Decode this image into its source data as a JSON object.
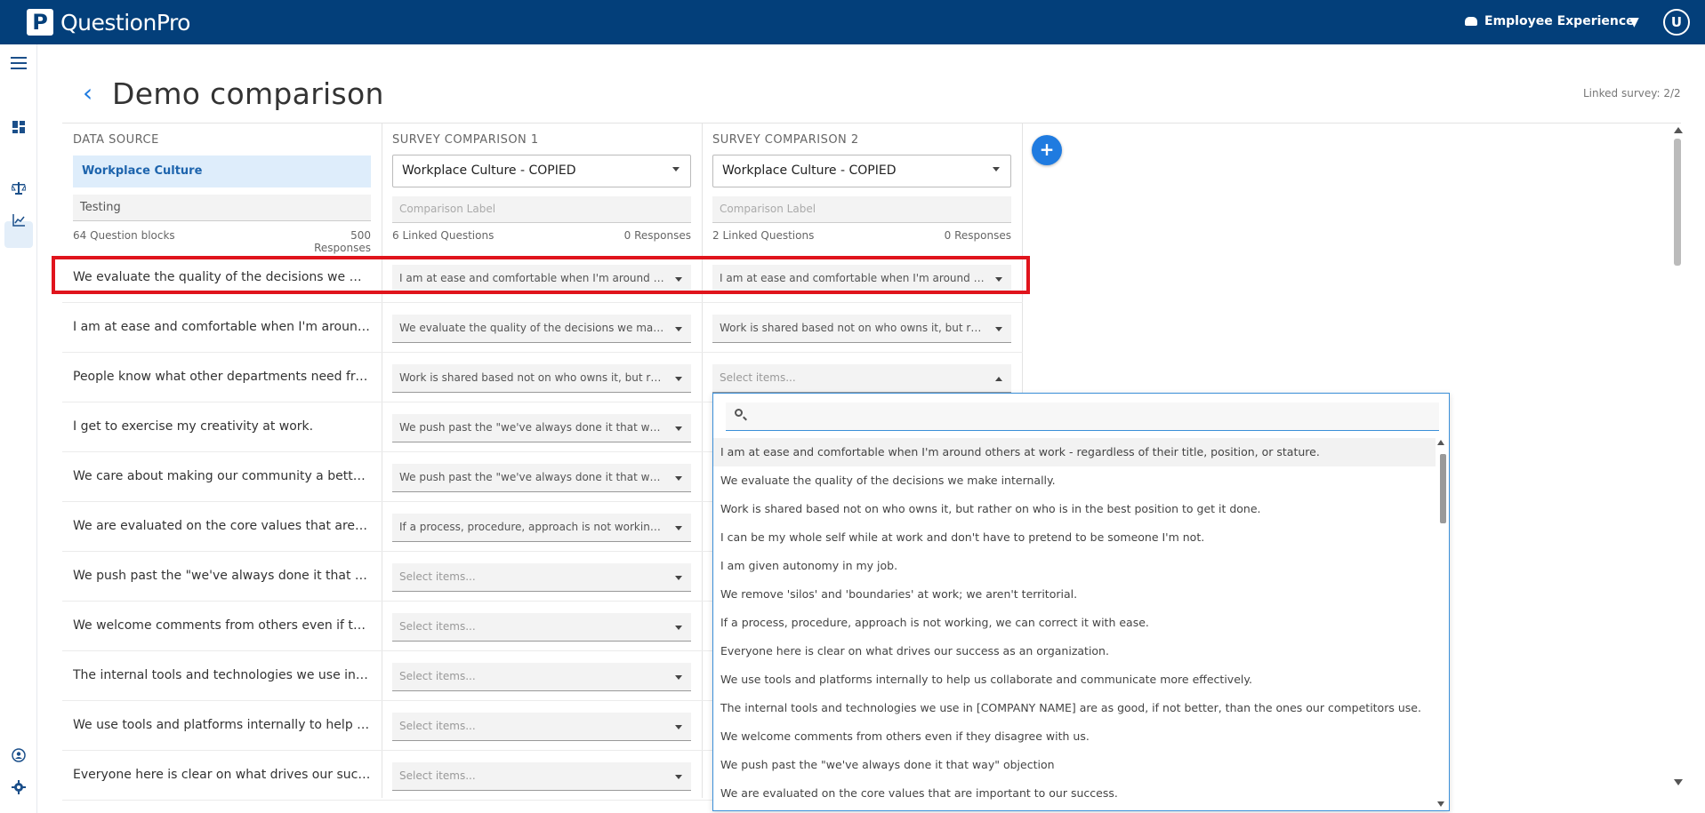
{
  "topbar": {
    "logo_letter": "P",
    "brand": "QuestionPro",
    "product": "Employee Experience",
    "product_caret": "▼",
    "avatar_letter": "U"
  },
  "rail": {
    "icons": [
      "menu-icon",
      "dashboard-icon",
      "compare-icon",
      "chart-icon",
      "user-shield-icon",
      "gear-icon"
    ]
  },
  "page": {
    "back_glyph": "‹",
    "title": "Demo comparison",
    "linked_survey": "Linked survey: 2/2"
  },
  "data_source": {
    "header": "DATA SOURCE",
    "selected": "Workplace Culture",
    "label_value": "Testing",
    "question_blocks": "64 Question blocks",
    "responses": "500 Responses"
  },
  "comparison1": {
    "header": "SURVEY COMPARISON 1",
    "survey": "Workplace Culture - COPIED",
    "label_placeholder": "Comparison Label",
    "linked_questions": "6 Linked Questions",
    "responses": "0 Responses"
  },
  "comparison2": {
    "header": "SURVEY COMPARISON 2",
    "survey": "Workplace Culture - COPIED",
    "label_placeholder": "Comparison Label",
    "linked_questions": "2 Linked Questions",
    "responses": "0 Responses"
  },
  "add_button": "+",
  "rows": [
    {
      "question": "We evaluate the quality of the decisions we make internally.",
      "c1": "I am at ease and comfortable when I'm around others at work - regardless of their title, position, or stature.",
      "c2": "I am at ease and comfortable when I'm around others at work - regardless of their title, position, or stature."
    },
    {
      "question": "I am at ease and comfortable when I'm around others at work - regardless of their title, position, or stature.",
      "c1": "We evaluate the quality of the decisions we make internally.",
      "c2": "Work is shared based not on who owns it, but rather on who is in the best position to get it done."
    },
    {
      "question": "People know what other departments need from them.",
      "c1": "Work is shared based not on who owns it, but rather on who is in the best position to get it done.",
      "c2": "Select items..."
    },
    {
      "question": "I get to exercise my creativity at work.",
      "c1": "We push past the \"we've always done it that way\" objection",
      "c2": ""
    },
    {
      "question": "We care about making our community a better place.",
      "c1": "We push past the \"we've always done it that way\" objection",
      "c2": ""
    },
    {
      "question": "We are evaluated on the core values that are important to our success.",
      "c1": "If a process, procedure, approach is not working, we can correct it with ease.",
      "c2": ""
    },
    {
      "question": "We push past the \"we've always done it that way\" objection",
      "c1": "Select items...",
      "c2": ""
    },
    {
      "question": "We welcome comments from others even if they disagree with us.",
      "c1": "Select items...",
      "c2": ""
    },
    {
      "question": "The internal tools and technologies we use in [COMPANY NAME] are as good, if not better, than the ones our competitors use.",
      "c1": "Select items...",
      "c2": ""
    },
    {
      "question": "We use tools and platforms internally to help us collaborate and communicate more effectively.",
      "c1": "Select items...",
      "c2": ""
    },
    {
      "question": "Everyone here is clear on what drives our success as an organization.",
      "c1": "Select items...",
      "c2": ""
    }
  ],
  "dropdown": {
    "search_value": "",
    "options": [
      "I am at ease and comfortable when I'm around others at work - regardless of their title, position, or stature.",
      "We evaluate the quality of the decisions we make internally.",
      "Work is shared based not on who owns it, but rather on who is in the best position to get it done.",
      "I can be my whole self while at work and don't have to pretend to be someone I'm not.",
      "I am given autonomy in my job.",
      "We remove 'silos' and 'boundaries' at work; we aren't territorial.",
      "If a process, procedure, approach is not working, we can correct it with ease.",
      "Everyone here is clear on what drives our success as an organization.",
      "We use tools and platforms internally to help us collaborate and communicate more effectively.",
      "The internal tools and technologies we use in [COMPANY NAME] are as good, if not better, than the ones our competitors use.",
      "We welcome comments from others even if they disagree with us.",
      "We push past the \"we've always done it that way\" objection",
      "We are evaluated on the core values that are important to our success."
    ]
  },
  "colors": {
    "topbar": "#033f7a",
    "accent": "#1f7be0",
    "highlight_border": "#e0141c"
  }
}
